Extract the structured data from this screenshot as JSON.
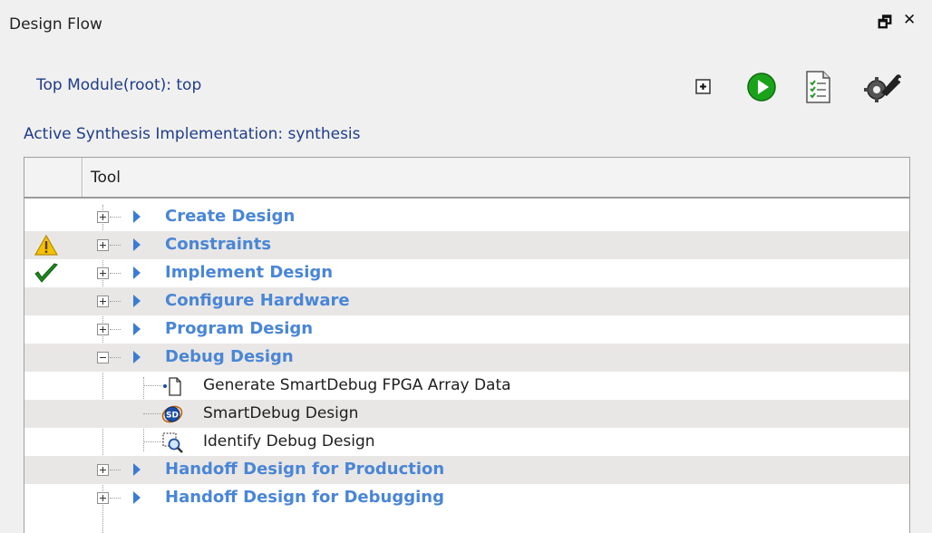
{
  "window": {
    "title": "Design Flow",
    "restore_glyph": "🗗",
    "close_glyph": "✕"
  },
  "header": {
    "top_module": "Top Module(root): top",
    "active_synthesis": "Active Synthesis Implementation: synthesis"
  },
  "toolbar": {
    "icons": [
      "expand-all-icon",
      "run-icon",
      "report-icon",
      "settings-icon"
    ]
  },
  "grid": {
    "column_header": "Tool",
    "rows": [
      {
        "label": "Create Design",
        "type": "group",
        "state": "collapsed",
        "status": ""
      },
      {
        "label": "Constraints",
        "type": "group",
        "state": "collapsed",
        "status": "warning"
      },
      {
        "label": "Implement Design",
        "type": "group",
        "state": "collapsed",
        "status": "success"
      },
      {
        "label": "Configure Hardware",
        "type": "group",
        "state": "collapsed",
        "status": ""
      },
      {
        "label": "Program Design",
        "type": "group",
        "state": "collapsed",
        "status": ""
      },
      {
        "label": "Debug Design",
        "type": "group",
        "state": "expanded",
        "status": ""
      },
      {
        "label": "Generate SmartDebug FPGA Array Data",
        "type": "child",
        "icon": "new-document-icon"
      },
      {
        "label": "SmartDebug Design",
        "type": "child",
        "icon": "smartdebug-icon"
      },
      {
        "label": "Identify Debug Design",
        "type": "child",
        "icon": "identify-search-icon"
      },
      {
        "label": "Handoff Design for Production",
        "type": "group",
        "state": "collapsed",
        "status": ""
      },
      {
        "label": "Handoff Design for Debugging",
        "type": "group",
        "state": "collapsed",
        "status": ""
      }
    ]
  },
  "colors": {
    "group_text": "#4a86d6",
    "arrow": "#3a7bd5",
    "header_text": "#1f3d8a",
    "alt_row": "#e9e7e5",
    "run_green": "#1aa31a",
    "check_green": "#1f8a1f",
    "warning_yellow": "#f2c200"
  }
}
